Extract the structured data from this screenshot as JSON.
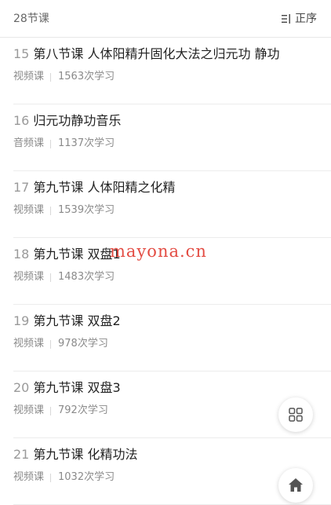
{
  "header": {
    "lesson_count": "28节课",
    "sort_label": "正序",
    "sort_icon": "sort-list-icon"
  },
  "lessons": [
    {
      "num": "15",
      "title": "第八节课 人体阳精升固化大法之归元功 静功",
      "type": "视频课",
      "views": "1563次学习"
    },
    {
      "num": "16",
      "title": "归元功静功音乐",
      "type": "音频课",
      "views": "1137次学习"
    },
    {
      "num": "17",
      "title": "第九节课 人体阳精之化精",
      "type": "视频课",
      "views": "1539次学习"
    },
    {
      "num": "18",
      "title": "第九节课 双盘1",
      "type": "视频课",
      "views": "1483次学习"
    },
    {
      "num": "19",
      "title": "第九节课 双盘2",
      "type": "视频课",
      "views": "978次学习"
    },
    {
      "num": "20",
      "title": "第九节课 双盘3",
      "type": "视频课",
      "views": "792次学习"
    },
    {
      "num": "21",
      "title": "第九节课 化精功法",
      "type": "视频课",
      "views": "1032次学习"
    }
  ],
  "watermark": "mayona.cn",
  "fabs": {
    "grid_icon": "grid-icon",
    "home_icon": "home-icon"
  }
}
